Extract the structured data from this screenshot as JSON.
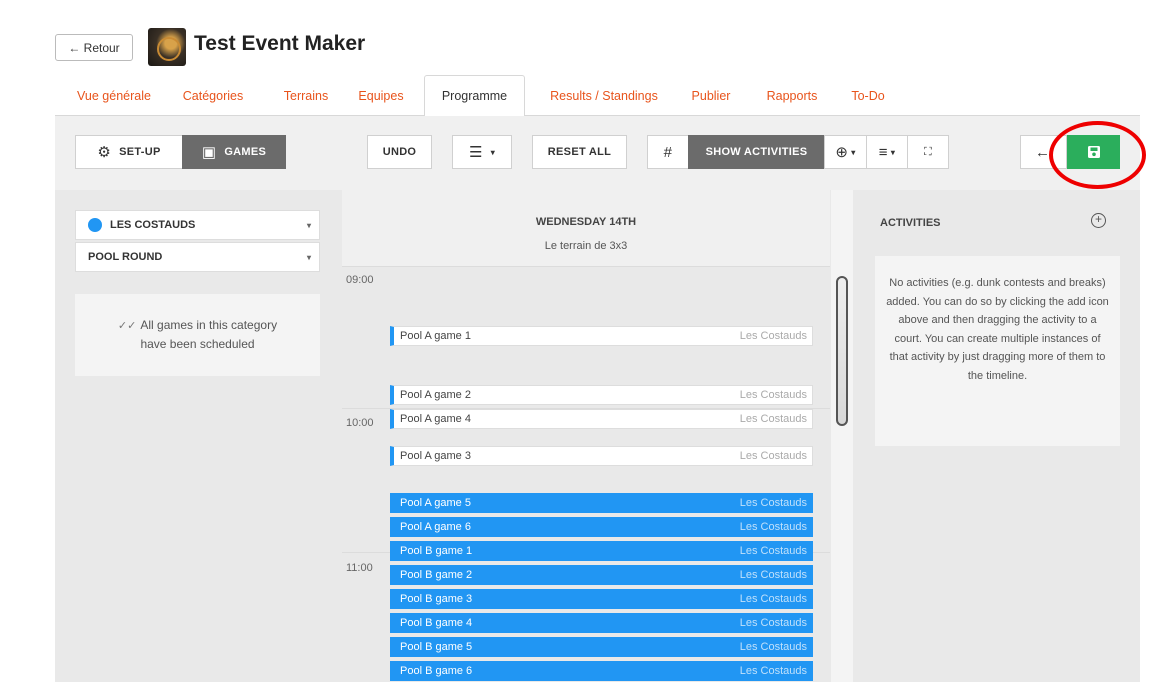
{
  "header": {
    "back_label": "← Retour",
    "title": "Test Event Maker"
  },
  "tabs": [
    {
      "label": "Vue générale",
      "active": false
    },
    {
      "label": "Catégories",
      "active": false
    },
    {
      "label": "Terrains",
      "active": false
    },
    {
      "label": "Equipes",
      "active": false
    },
    {
      "label": "Programme",
      "active": true
    },
    {
      "label": "Results / Standings",
      "active": false
    },
    {
      "label": "Publier",
      "active": false
    },
    {
      "label": "Rapports",
      "active": false
    },
    {
      "label": "To-Do",
      "active": false
    }
  ],
  "toolbar": {
    "setup_label": "SET-UP",
    "games_label": "GAMES",
    "undo_label": "UNDO",
    "sort_icon": "☰",
    "reset_label": "RESET ALL",
    "hash_label": "#",
    "show_activities_label": "SHOW ACTIVITIES",
    "add_icon": "⊕",
    "filter_icon": "≡",
    "fullscreen_icon": "⛶",
    "arrow_icon": "←",
    "save_icon": "💾",
    "save_color": "#2bae5c"
  },
  "left": {
    "team_select": "LES COSTAUDS",
    "round_select": "POOL ROUND",
    "scheduled_note": "All games in this category have been scheduled",
    "team_color": "#2196f3"
  },
  "timeline": {
    "day": "WEDNESDAY 14TH",
    "court": "Le terrain de 3x3",
    "times": [
      "09:00",
      "10:00",
      "11:00"
    ],
    "games": [
      {
        "name": "Pool A game 1",
        "team": "Les Costauds",
        "style": "white"
      },
      {
        "name": "Pool A game 2",
        "team": "Les Costauds",
        "style": "white"
      },
      {
        "name": "Pool A game 4",
        "team": "Les Costauds",
        "style": "white"
      },
      {
        "name": "Pool A game 3",
        "team": "Les Costauds",
        "style": "white"
      },
      {
        "name": "Pool A game 5",
        "team": "Les Costauds",
        "style": "blue"
      },
      {
        "name": "Pool A game 6",
        "team": "Les Costauds",
        "style": "blue"
      },
      {
        "name": "Pool B game 1",
        "team": "Les Costauds",
        "style": "blue"
      },
      {
        "name": "Pool B game 2",
        "team": "Les Costauds",
        "style": "blue"
      },
      {
        "name": "Pool B game 3",
        "team": "Les Costauds",
        "style": "blue"
      },
      {
        "name": "Pool B game 4",
        "team": "Les Costauds",
        "style": "blue"
      },
      {
        "name": "Pool B game 5",
        "team": "Les Costauds",
        "style": "blue"
      },
      {
        "name": "Pool B game 6",
        "team": "Les Costauds",
        "style": "blue"
      }
    ]
  },
  "activities": {
    "title": "ACTIVITIES",
    "empty_text": "No activities (e.g. dunk contests and breaks) added. You can do so by clicking the add icon above and then dragging the activity to a court. You can create multiple instances of that activity by just dragging more of them to the timeline."
  }
}
